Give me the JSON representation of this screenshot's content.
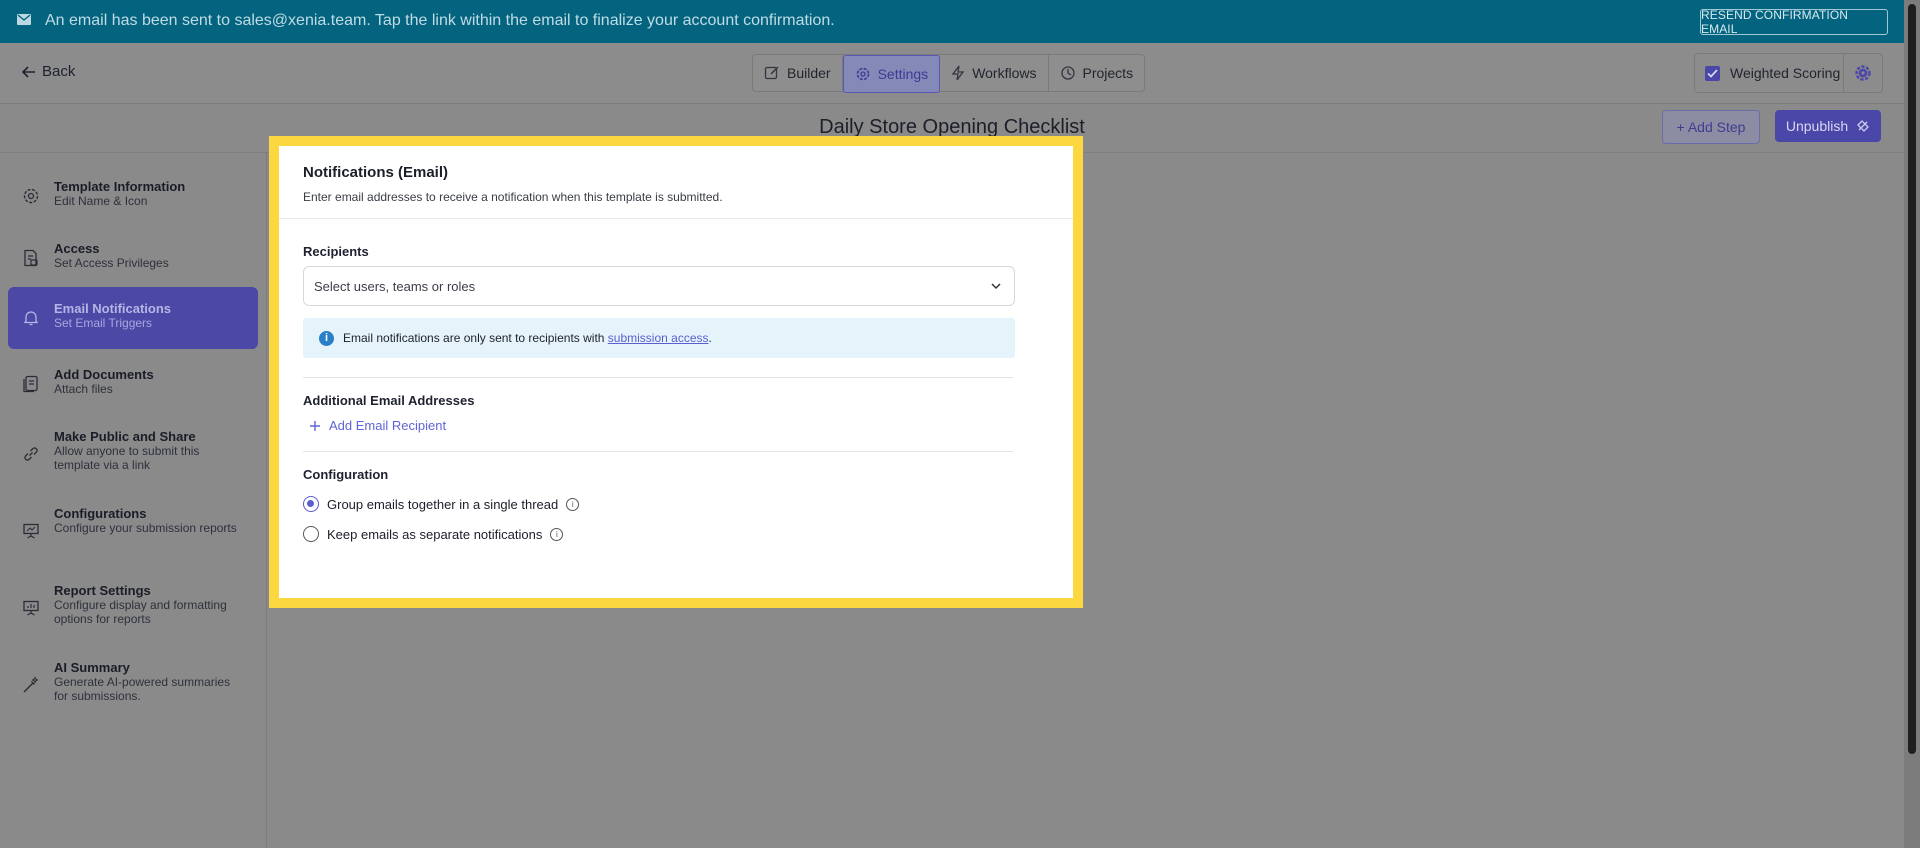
{
  "banner": {
    "message": "An email has been sent to sales@xenia.team. Tap the link within the email to finalize your account confirmation.",
    "resend_label": "RESEND CONFIRMATION EMAIL"
  },
  "header": {
    "back_label": "Back",
    "tabs": [
      {
        "label": "Builder",
        "icon": "edit-icon"
      },
      {
        "label": "Settings",
        "icon": "gear-icon",
        "active": true
      },
      {
        "label": "Workflows",
        "icon": "lightning-icon"
      },
      {
        "label": "Projects",
        "icon": "clock-icon"
      }
    ],
    "weighted_scoring_label": "Weighted Scoring",
    "weighted_scoring_checked": true
  },
  "titlebar": {
    "title": "Daily Store Opening Checklist",
    "add_step_label": "+ Add Step",
    "unpublish_label": "Unpublish"
  },
  "sidebar": {
    "items": [
      {
        "title": "Template Information",
        "subtitle": "Edit Name & Icon",
        "icon": "gear-icon"
      },
      {
        "title": "Access",
        "subtitle": "Set Access Privileges",
        "icon": "document-lock-icon"
      },
      {
        "title": "Email Notifications",
        "subtitle": "Set Email Triggers",
        "icon": "bell-icon",
        "active": true
      },
      {
        "title": "Add Documents",
        "subtitle": "Attach files",
        "icon": "documents-icon"
      },
      {
        "title": "Make Public and Share",
        "subtitle": "Allow anyone to submit this template via a link",
        "icon": "link-icon"
      },
      {
        "title": "Configurations",
        "subtitle": "Configure your submission reports",
        "icon": "presentation-icon"
      },
      {
        "title": "Report Settings",
        "subtitle": "Configure display and formatting options for reports",
        "icon": "report-icon"
      },
      {
        "title": "AI Summary",
        "subtitle": "Generate AI-powered summaries for submissions.",
        "icon": "magic-wand-icon"
      }
    ]
  },
  "modal": {
    "title": "Notifications (Email)",
    "subtitle": "Enter email addresses to receive a notification when this template is submitted.",
    "recipients_label": "Recipients",
    "recipients_placeholder": "Select users, teams or roles",
    "info_text": "Email notifications are only sent to recipients with ",
    "info_link": "submission access",
    "info_suffix": ".",
    "additional_label": "Additional Email Addresses",
    "add_recipient_label": "Add Email Recipient",
    "config_label": "Configuration",
    "options": [
      {
        "label": "Group emails together in a single thread",
        "selected": true
      },
      {
        "label": "Keep emails as separate notifications",
        "selected": false
      }
    ]
  },
  "colors": {
    "banner": "#04647f",
    "accent": "#4b47a8",
    "highlight_frame": "#fdd73f",
    "overlay": "#8a8a8a"
  }
}
